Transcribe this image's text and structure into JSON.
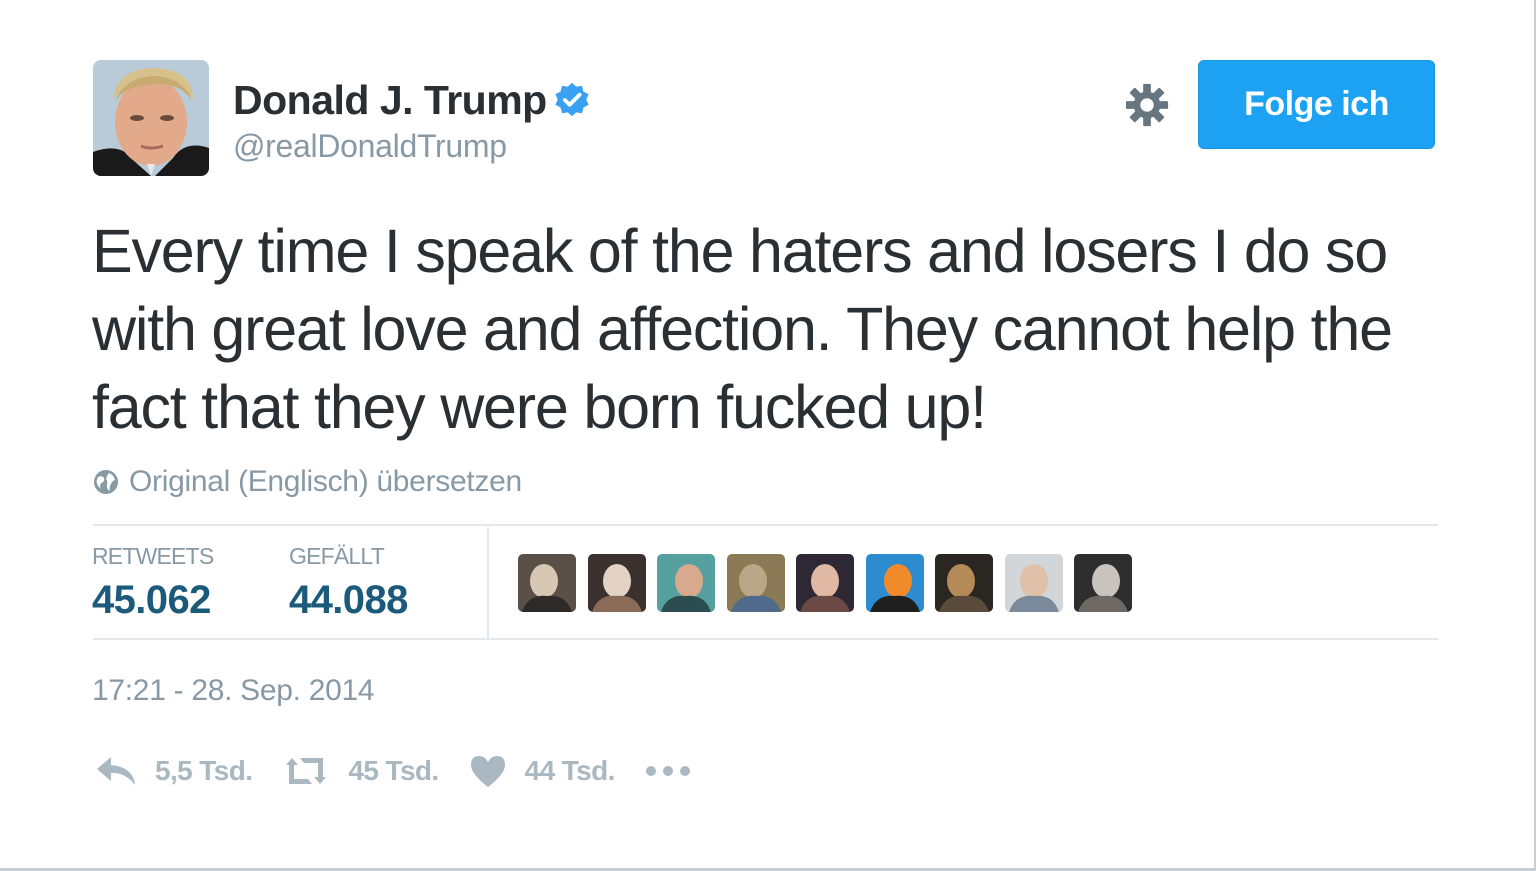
{
  "user": {
    "display_name": "Donald J. Trump",
    "handle": "@realDonaldTrump",
    "verified": true,
    "avatar_icon": "profile-photo"
  },
  "header": {
    "settings_icon": "gear-icon",
    "follow_label": "Folge ich"
  },
  "tweet": {
    "text": "Every time I speak of the haters and losers I do so with great love and affection. They cannot help the fact that they were born fucked up!"
  },
  "translate": {
    "icon": "globe-icon",
    "label": "Original (Englisch) übersetzen"
  },
  "stats": {
    "retweets_label": "RETWEETS",
    "retweets_value": "45.062",
    "likes_label": "GEFÄLLT",
    "likes_value": "44.088",
    "liker_avatars": [
      {
        "colors": [
          "#5a5048",
          "#d8c7b3",
          "#2e2a27"
        ]
      },
      {
        "colors": [
          "#3b3230",
          "#e2d3c4",
          "#8a6b57"
        ]
      },
      {
        "colors": [
          "#57a0a0",
          "#d8a98d",
          "#2c4d4f"
        ]
      },
      {
        "colors": [
          "#8a7a55",
          "#b8a888",
          "#4f6a8a"
        ]
      },
      {
        "colors": [
          "#2e2834",
          "#e0b9a5",
          "#6b4a45"
        ]
      },
      {
        "colors": [
          "#2d8bd0",
          "#f08a2a",
          "#1f1f1f"
        ]
      },
      {
        "colors": [
          "#2a2622",
          "#b48a58",
          "#5a4a3a"
        ]
      },
      {
        "colors": [
          "#d2d6d8",
          "#e0c0a8",
          "#7a8a9a"
        ]
      },
      {
        "colors": [
          "#2e2e2e",
          "#c9c3bd",
          "#6e6862"
        ]
      }
    ]
  },
  "timestamp": "17:21 - 28. Sep. 2014",
  "actions": {
    "reply_icon": "reply-icon",
    "reply_count": "5,5 Tsd.",
    "retweet_icon": "retweet-icon",
    "retweet_count": "45 Tsd.",
    "like_icon": "heart-icon",
    "like_count": "44 Tsd.",
    "more_icon": "more-dots-icon"
  },
  "colors": {
    "accent": "#1da1f2",
    "text": "#292f33",
    "muted": "#8899a6",
    "stat_value": "#1b5a7a",
    "action_gray": "#aab8c2"
  }
}
